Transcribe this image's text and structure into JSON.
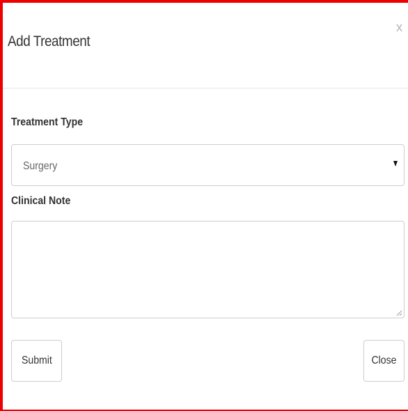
{
  "modal": {
    "title": "Add Treatment",
    "close_glyph": "x",
    "close_icon": "close-icon"
  },
  "form": {
    "treatment_type": {
      "label": "Treatment Type",
      "selected": "Surgery",
      "arrow_icon": "caret-down-icon"
    },
    "clinical_note": {
      "label": "Clinical Note",
      "value": ""
    }
  },
  "footer": {
    "submit_label": "Submit",
    "close_label": "Close"
  },
  "colors": {
    "border_highlight": "#ee0000",
    "input_border": "#cccccc",
    "close_x": "#b5b5b5"
  }
}
